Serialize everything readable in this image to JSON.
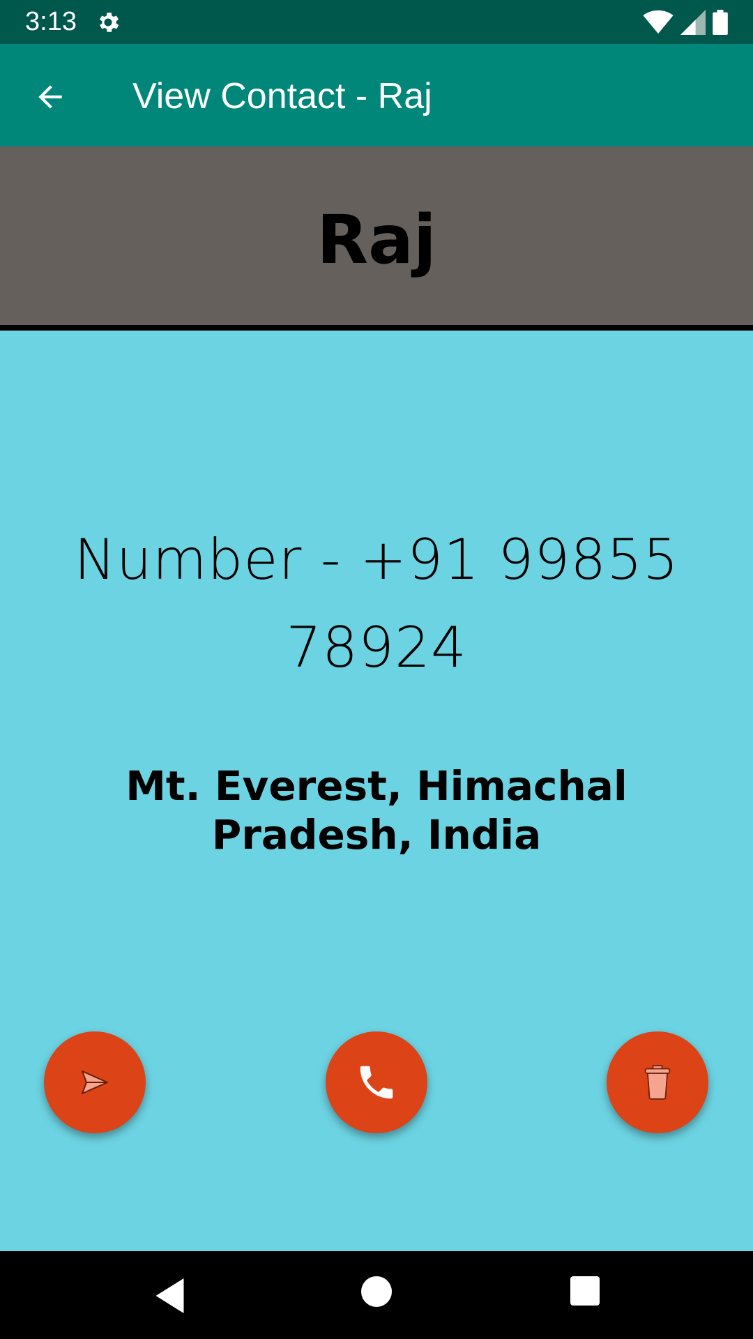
{
  "status_bar": {
    "time": "3:13",
    "icons": [
      "settings-icon",
      "wifi-icon",
      "signal-icon",
      "battery-icon"
    ]
  },
  "app_bar": {
    "title": "View Contact - Raj",
    "back_icon": "arrow-left-icon",
    "background_color": "#00877a"
  },
  "contact": {
    "name": "Raj",
    "number": "Number - +91 99855 78924",
    "address": "Mt. Everest, Himachal Pradesh, India"
  },
  "actions": {
    "send_icon": "send-icon",
    "call_icon": "phone-icon",
    "delete_icon": "trash-icon",
    "fab_color": "#dc4316"
  },
  "colors": {
    "page_background": "#6cd3e2",
    "banner_background": "#65605b",
    "status_bar": "#00574b"
  },
  "nav_bar": {
    "icons": [
      "nav-back-icon",
      "nav-home-icon",
      "nav-recents-icon"
    ]
  }
}
